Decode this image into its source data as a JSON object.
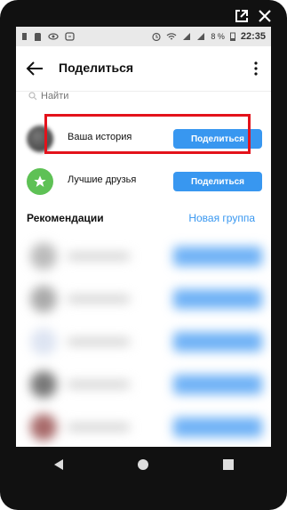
{
  "status_bar": {
    "battery": "8 %",
    "time": "22:35"
  },
  "header": {
    "title": "Поделиться"
  },
  "search": {
    "placeholder": "Найти"
  },
  "share_rows": [
    {
      "label": "Ваша история",
      "button": "Поделиться"
    },
    {
      "label": "Лучшие друзья",
      "button": "Поделиться"
    }
  ],
  "recommendations": {
    "title": "Рекомендации",
    "new_group": "Новая группа"
  },
  "colors": {
    "accent": "#3897f0",
    "highlight": "#e3121b",
    "close_friends": "#5ec155"
  },
  "icons": [
    "external-link-icon",
    "close-icon",
    "back-arrow-icon",
    "more-vert-icon",
    "search-icon",
    "star-icon",
    "back-nav-icon",
    "home-nav-icon",
    "recents-nav-icon"
  ]
}
